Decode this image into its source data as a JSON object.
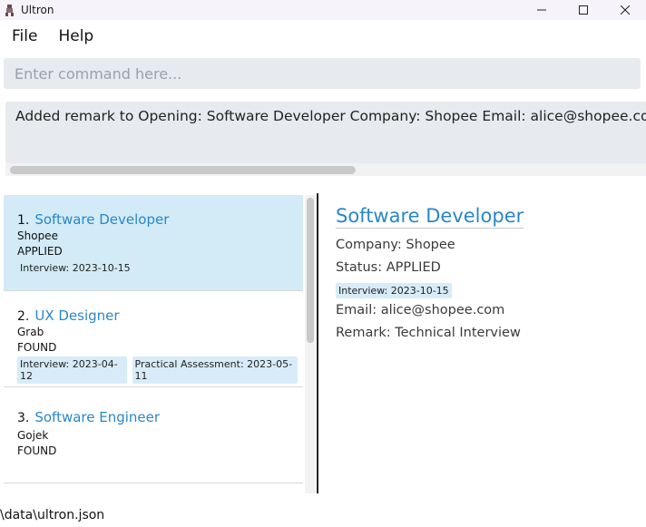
{
  "window": {
    "title": "Ultron",
    "minimize": "—",
    "maximize": "☐",
    "close": "✕"
  },
  "menu": {
    "items": [
      "File",
      "Help"
    ]
  },
  "command": {
    "placeholder": "Enter command here...",
    "value": ""
  },
  "result": {
    "text": "Added remark to Opening: Software Developer Company: Shopee Email: alice@shopee.com Status: APPLIED Remark: Technical Interview"
  },
  "list": {
    "openings": [
      {
        "index": "1.",
        "title": "Software Developer",
        "company": "Shopee",
        "status": "APPLIED",
        "dates": [
          "Interview: 2023-10-15"
        ]
      },
      {
        "index": "2.",
        "title": "UX Designer",
        "company": "Grab",
        "status": "FOUND",
        "dates": [
          "Interview: 2023-04-12",
          "Practical Assessment: 2023-05-11"
        ]
      },
      {
        "index": "3.",
        "title": "Software Engineer",
        "company": "Gojek",
        "status": "FOUND",
        "dates": []
      }
    ]
  },
  "detail": {
    "title": "Software Developer",
    "company": "Company: Shopee",
    "status": "Status: APPLIED",
    "date": "Interview: 2023-10-15",
    "email": "Email: alice@shopee.com",
    "remark": "Remark: Technical Interview"
  },
  "status_bar": {
    "path": "\\data\\ultron.json"
  },
  "colors": {
    "accent": "#2a87c8",
    "selected_row": "#d2ebf7",
    "tag_bg": "#d7ecf8",
    "input_bg": "#e7eaee"
  }
}
